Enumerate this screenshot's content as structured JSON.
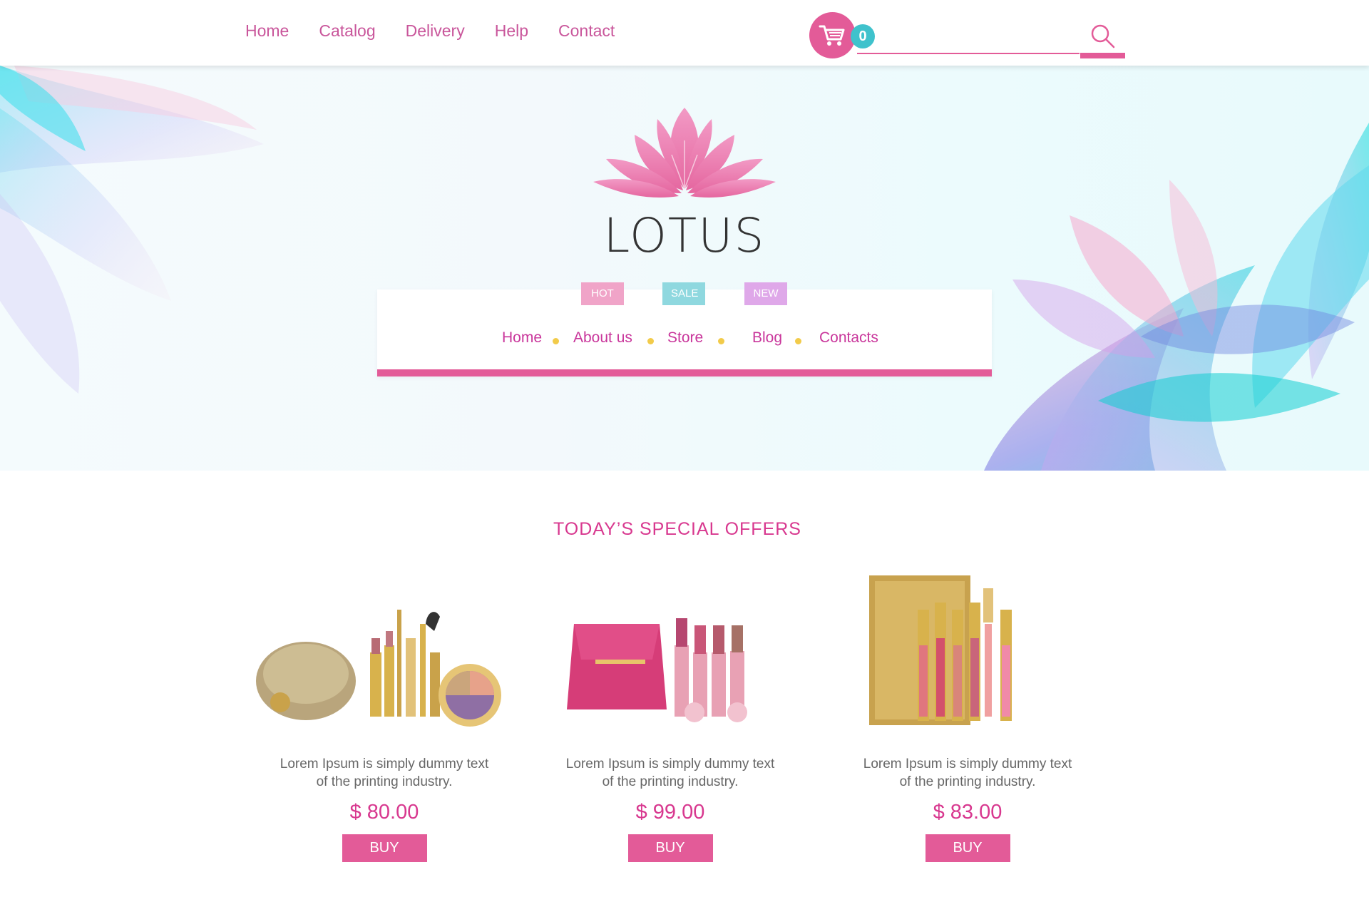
{
  "topbar": {
    "nav": [
      "Home",
      "Catalog",
      "Delivery",
      "Help",
      "Contact"
    ],
    "cart_count": "0",
    "search_placeholder": ""
  },
  "brand": {
    "name": "LOTUS"
  },
  "menu": {
    "items": [
      "Home",
      "About us",
      "Store",
      "Blog",
      "Contacts"
    ],
    "tags": {
      "hot": "HOT",
      "sale": "SALE",
      "new": "NEW"
    }
  },
  "offers": {
    "title": "TODAY’S SPECIAL OFFERS",
    "products": [
      {
        "desc": "Lorem Ipsum is simply dummy text\nof the printing  industry.",
        "price": "$ 80.00",
        "buy": "BUY"
      },
      {
        "desc": "Lorem Ipsum is simply dummy text\nof the printing industry.",
        "price": "$ 99.00",
        "buy": "BUY"
      },
      {
        "desc": "Lorem Ipsum is simply dummy text\nof the printing industry.",
        "price": "$ 83.00",
        "buy": "BUY"
      }
    ]
  },
  "colors": {
    "accent": "#e35b98",
    "text_pink": "#c9569b",
    "badge": "#3fc2cc",
    "dot": "#f2cb4a"
  },
  "icons": {
    "cart": "shopping-cart-icon",
    "search": "search-icon",
    "logo": "lotus-flower-icon"
  }
}
